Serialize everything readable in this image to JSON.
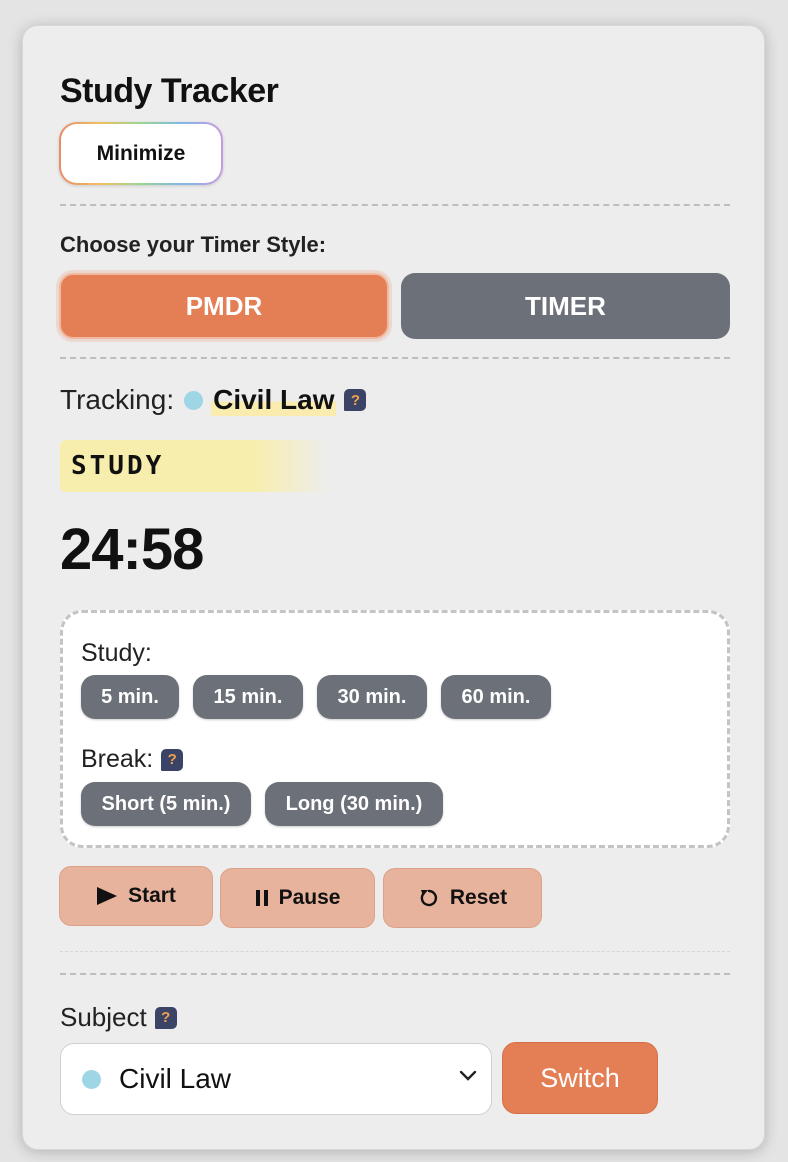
{
  "app": {
    "title": "Study Tracker",
    "minimize_label": "Minimize"
  },
  "timer_style": {
    "prompt": "Choose your Timer Style:",
    "options": [
      {
        "label": "PMDR",
        "selected": true
      },
      {
        "label": "TIMER",
        "selected": false
      }
    ]
  },
  "tracking": {
    "label": "Tracking:",
    "subject": "Civil Law",
    "subject_color": "#9fd6e6",
    "help_icon": "question-icon"
  },
  "mode_badge": "STUDY",
  "clock": "24:58",
  "presets": {
    "study_label": "Study:",
    "study_options": [
      "5 min.",
      "15 min.",
      "30 min.",
      "60 min."
    ],
    "break_label": "Break:",
    "break_options": [
      "Short (5 min.)",
      "Long (30 min.)"
    ]
  },
  "controls": {
    "start": "Start",
    "pause": "Pause",
    "reset": "Reset"
  },
  "subject_picker": {
    "label": "Subject",
    "selected": "Civil Law",
    "switch_label": "Switch"
  },
  "colors": {
    "accent": "#e47e54",
    "neutral_button": "#6b7079",
    "highlight": "#f7eeae",
    "action_button": "#e8b39d"
  }
}
